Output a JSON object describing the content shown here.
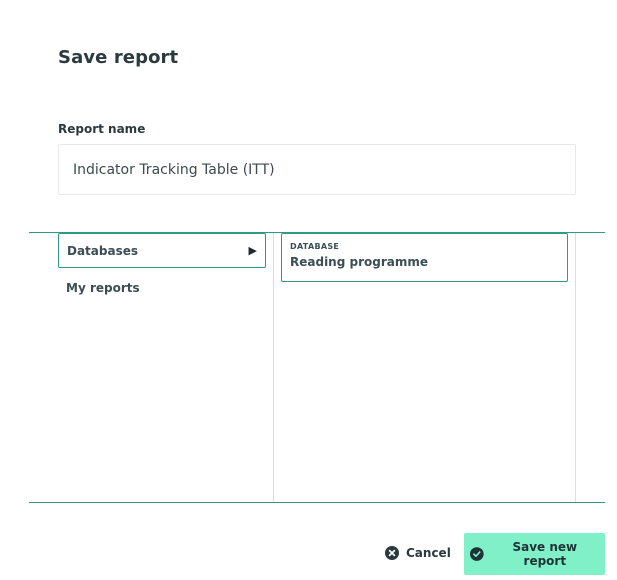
{
  "dialog": {
    "title": "Save report",
    "report_name_label": "Report name",
    "report_name_value": "Indicator Tracking Table (ITT)"
  },
  "nav": {
    "items": [
      {
        "label": "Databases",
        "active": true,
        "arrow": "▶"
      },
      {
        "label": "My reports",
        "active": false
      }
    ]
  },
  "databases": [
    {
      "type": "DATABASE",
      "name": "Reading programme"
    }
  ],
  "actions": {
    "cancel_label": "Cancel",
    "cancel_icon": "close-circle-icon",
    "save_label": "Save new report",
    "save_icon": "check-circle-icon"
  },
  "colors": {
    "accent": "#2e9a84",
    "save_button_bg": "#7ff0c8",
    "text": "#2b3a3e"
  }
}
